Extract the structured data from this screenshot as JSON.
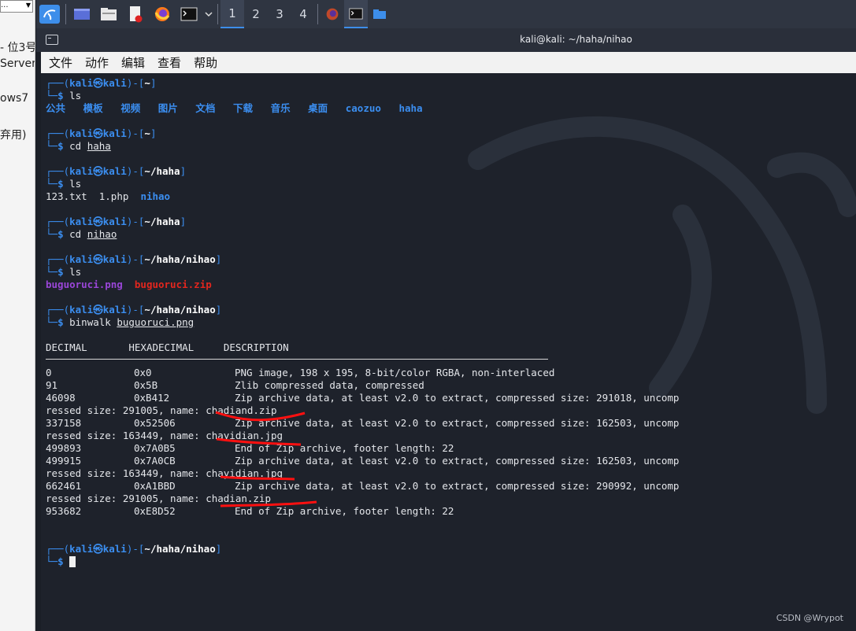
{
  "left_strip": {
    "dropdown": "...",
    "items": [
      "- 位3号",
      "Server",
      "ows7",
      "弃用)"
    ]
  },
  "taskbar": {
    "workspaces": [
      "1",
      "2",
      "3",
      "4"
    ],
    "active_workspace": "1"
  },
  "window": {
    "title": "kali@kali: ~/haha/nihao"
  },
  "menu": [
    "文件",
    "动作",
    "编辑",
    "查看",
    "帮助"
  ],
  "prompt": {
    "top_open": "┌──(",
    "user": "kali",
    "at": "㉿",
    "host": "kali",
    "mid": ")-[",
    "close": "]",
    "bottom": "└─",
    "dollar": "$"
  },
  "terminal": {
    "blocks": [
      {
        "path": "~",
        "command": "ls",
        "arg": "",
        "output_dirs": [
          "公共",
          "模板",
          "视频",
          "图片",
          "文档",
          "下载",
          "音乐",
          "桌面",
          "caozuo",
          "haha"
        ]
      },
      {
        "path": "~",
        "command": "cd",
        "arg": "haha"
      },
      {
        "path": "~/haha",
        "command": "ls",
        "arg": "",
        "output_files": [
          "123.txt",
          "1.php"
        ],
        "output_dir": "nihao"
      },
      {
        "path": "~/haha",
        "command": "cd",
        "arg": "nihao"
      },
      {
        "path": "~/haha/nihao",
        "command": "ls",
        "arg": "",
        "output_image": "buguoruci.png",
        "output_archive": "buguoruci.zip"
      },
      {
        "path": "~/haha/nihao",
        "command": "binwalk",
        "arg": "buguoruci.png"
      }
    ],
    "headers": [
      "DECIMAL",
      "HEXADECIMAL",
      "DESCRIPTION"
    ],
    "rows": [
      [
        "0",
        "0x0",
        "PNG image, 198 x 195, 8-bit/color RGBA, non-interlaced"
      ],
      [
        "91",
        "0x5B",
        "Zlib compressed data, compressed"
      ],
      [
        "46098",
        "0xB412",
        "Zip archive data, at least v2.0 to extract, compressed size: 291018, uncomp"
      ],
      [
        "",
        "",
        "ressed size: 291005, name: chadiand.zip"
      ],
      [
        "337158",
        "0x52506",
        "Zip archive data, at least v2.0 to extract, compressed size: 162503, uncomp"
      ],
      [
        "",
        "",
        "ressed size: 163449, name: chayidian.jpg"
      ],
      [
        "499893",
        "0x7A0B5",
        "End of Zip archive, footer length: 22"
      ],
      [
        "499915",
        "0x7A0CB",
        "Zip archive data, at least v2.0 to extract, compressed size: 162503, uncomp"
      ],
      [
        "",
        "",
        "ressed size: 163449, name: chayidian.jpg"
      ],
      [
        "662461",
        "0xA1BBD",
        "Zip archive data, at least v2.0 to extract, compressed size: 290992, uncomp"
      ],
      [
        "",
        "",
        "ressed size: 291005, name: chadian.zip"
      ],
      [
        "953682",
        "0xE8D52",
        "End of Zip archive, footer length: 22"
      ]
    ],
    "final_path": "~/haha/nihao"
  },
  "watermark": "CSDN @Wrypot",
  "colors": {
    "prompt_blue": "#3b8ef0",
    "png_purple": "#9a46d8",
    "zip_red": "#e2261e",
    "annotation_red": "#ff1010"
  }
}
